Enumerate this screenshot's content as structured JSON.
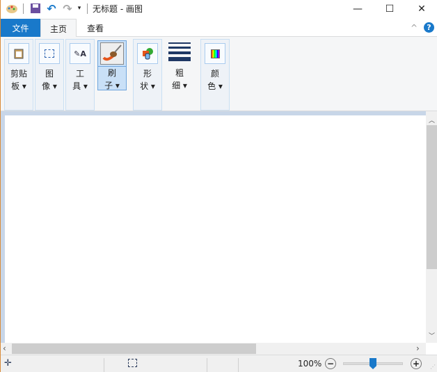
{
  "window": {
    "title": "无标题 - 画图",
    "minimize": "—",
    "maximize": "☐",
    "close": "✕"
  },
  "tabs": {
    "file": "文件",
    "home": "主页",
    "view": "查看"
  },
  "ribbon": {
    "help": "?",
    "collapse": "^",
    "groups": [
      {
        "l1": "剪贴",
        "l2": "板 ▾"
      },
      {
        "l1": "图",
        "l2": "像 ▾"
      },
      {
        "l1": "工",
        "l2": "具 ▾"
      },
      {
        "l1": "刷",
        "l2": "子 ▾"
      },
      {
        "l1": "形",
        "l2": "状 ▾"
      },
      {
        "l1": "粗",
        "l2": "细 ▾"
      },
      {
        "l1": "颜",
        "l2": "色 ▾"
      }
    ]
  },
  "status": {
    "zoom": "100%",
    "zoom_fraction": 0.5
  },
  "colors": {
    "accent": "#1979ca"
  }
}
